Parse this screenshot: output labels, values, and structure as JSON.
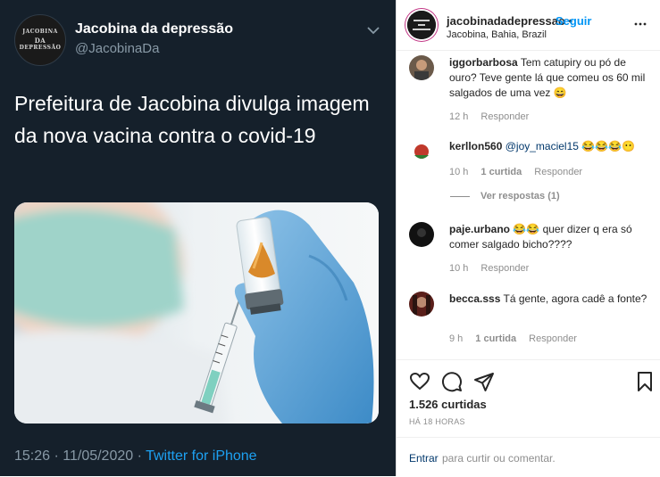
{
  "tweet": {
    "author_name": "Jacobina da depressão",
    "handle": "@JacobinaDa",
    "avatar_text": [
      "JACOBINA",
      "DA",
      "DEPRESSÃO"
    ],
    "text": "Prefeitura de Jacobina divulga imagem da nova vacina contra o covid-19",
    "timestamp": "15:26 · 11/05/2020 · ",
    "source": "Twitter for iPhone",
    "image_icon": "vaccine-photo-with-coxinha"
  },
  "instagram": {
    "username": "jacobinadadepressao",
    "dot": "•",
    "follow_label": "Seguir",
    "location": "Jacobina, Bahia, Brazil",
    "comments": [
      {
        "user": "iggorbarbosa",
        "text": "Tem catupiry ou pó de ouro? Teve gente lá que comeu os 60 mil salgados de uma vez 😄",
        "time": "12 h",
        "reply": "Responder"
      },
      {
        "user": "kerllon560",
        "mention": "@joy_maciel15",
        "text": "😂😂😂😶",
        "time": "10 h",
        "likes": "1 curtida",
        "reply": "Responder"
      },
      {
        "user": "paje.urbano",
        "text": "😂😂 quer dizer q era só comer salgado bicho????",
        "time": "10 h",
        "reply": "Responder"
      },
      {
        "user": "becca.sss",
        "text": "Tá gente, agora cadê a fonte?",
        "time": "9 h",
        "likes": "1 curtida",
        "reply": "Responder"
      }
    ],
    "view_replies": "Ver respostas (1)",
    "likes": "1.526 curtidas",
    "posted_ago": "HÁ 18 HORAS",
    "login_link": "Entrar",
    "comment_prompt": "para curtir ou comentar."
  }
}
